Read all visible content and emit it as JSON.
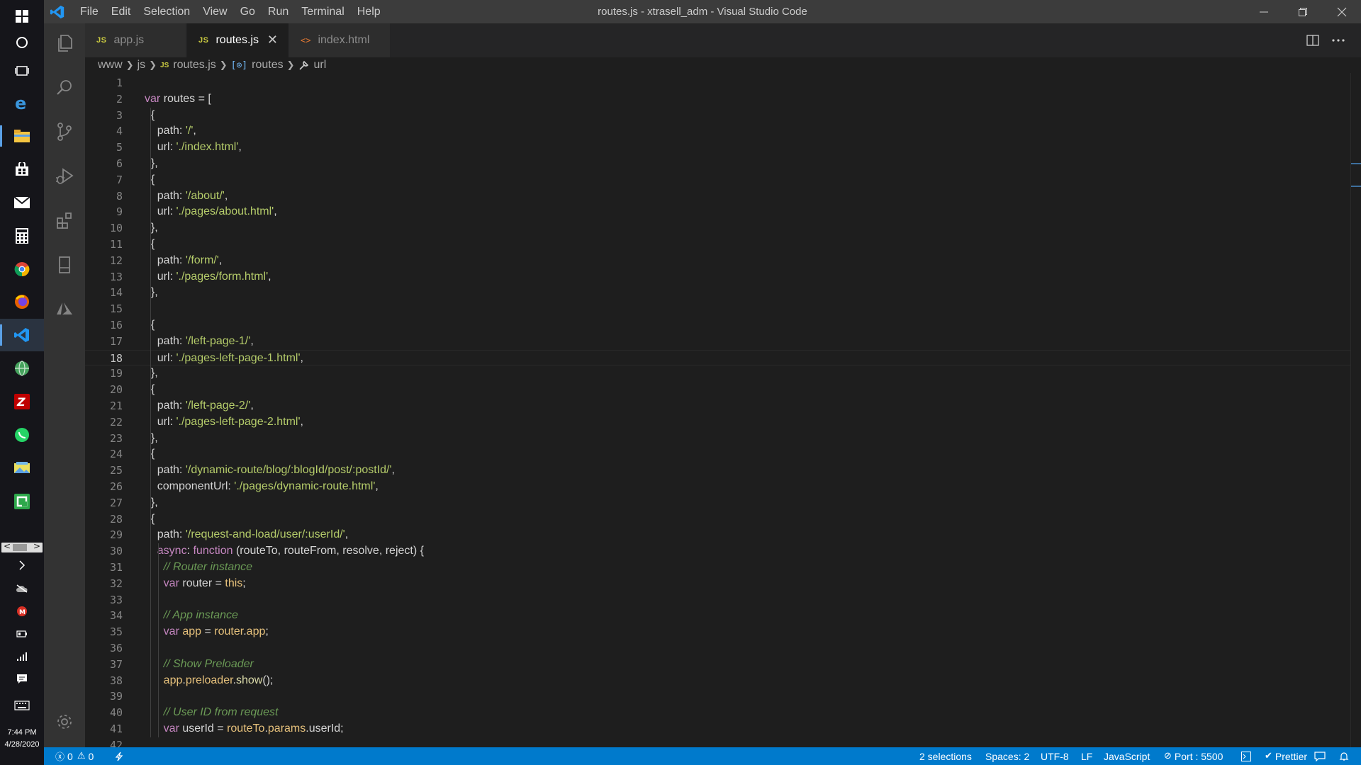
{
  "window": {
    "title": "routes.js - xtrasell_adm - Visual Studio Code"
  },
  "menu": [
    "File",
    "Edit",
    "Selection",
    "View",
    "Go",
    "Run",
    "Terminal",
    "Help"
  ],
  "taskbar": {
    "clock_time": "7:44 PM",
    "clock_date": "4/28/2020"
  },
  "tabs": [
    {
      "label": "app.js",
      "type": "js"
    },
    {
      "label": "routes.js",
      "type": "js",
      "active": true
    },
    {
      "label": "index.html",
      "type": "html"
    }
  ],
  "breadcrumbs": [
    "www",
    "js",
    "routes.js",
    "routes",
    "url"
  ],
  "editor": {
    "current_line": 18,
    "lines": [
      "",
      "var routes = [",
      "  {",
      "    path: '/',",
      "    url: './index.html',",
      "  },",
      "  {",
      "    path: '/about/',",
      "    url: './pages/about.html',",
      "  },",
      "  {",
      "    path: '/form/',",
      "    url: './pages/form.html',",
      "  },",
      "",
      "  {",
      "    path: '/left-page-1/',",
      "    url: './pages-left-page-1.html',",
      "  },",
      "  {",
      "    path: '/left-page-2/',",
      "    url: './pages-left-page-2.html',",
      "  },",
      "  {",
      "    path: '/dynamic-route/blog/:blogId/post/:postId/',",
      "    componentUrl: './pages/dynamic-route.html',",
      "  },",
      "  {",
      "    path: '/request-and-load/user/:userId/',",
      "    async: function (routeTo, routeFrom, resolve, reject) {",
      "      // Router instance",
      "      var router = this;",
      "",
      "      // App instance",
      "      var app = router.app;",
      "",
      "      // Show Preloader",
      "      app.preloader.show();",
      "",
      "      // User ID from request",
      "      var userId = routeTo.params.userId;",
      ""
    ]
  },
  "statusbar": {
    "errors": "0",
    "warnings": "0",
    "selections": "2 selections",
    "spaces": "Spaces: 2",
    "encoding": "UTF-8",
    "eol": "LF",
    "language": "JavaScript",
    "port": "Port : 5500",
    "formatter": "Prettier"
  }
}
